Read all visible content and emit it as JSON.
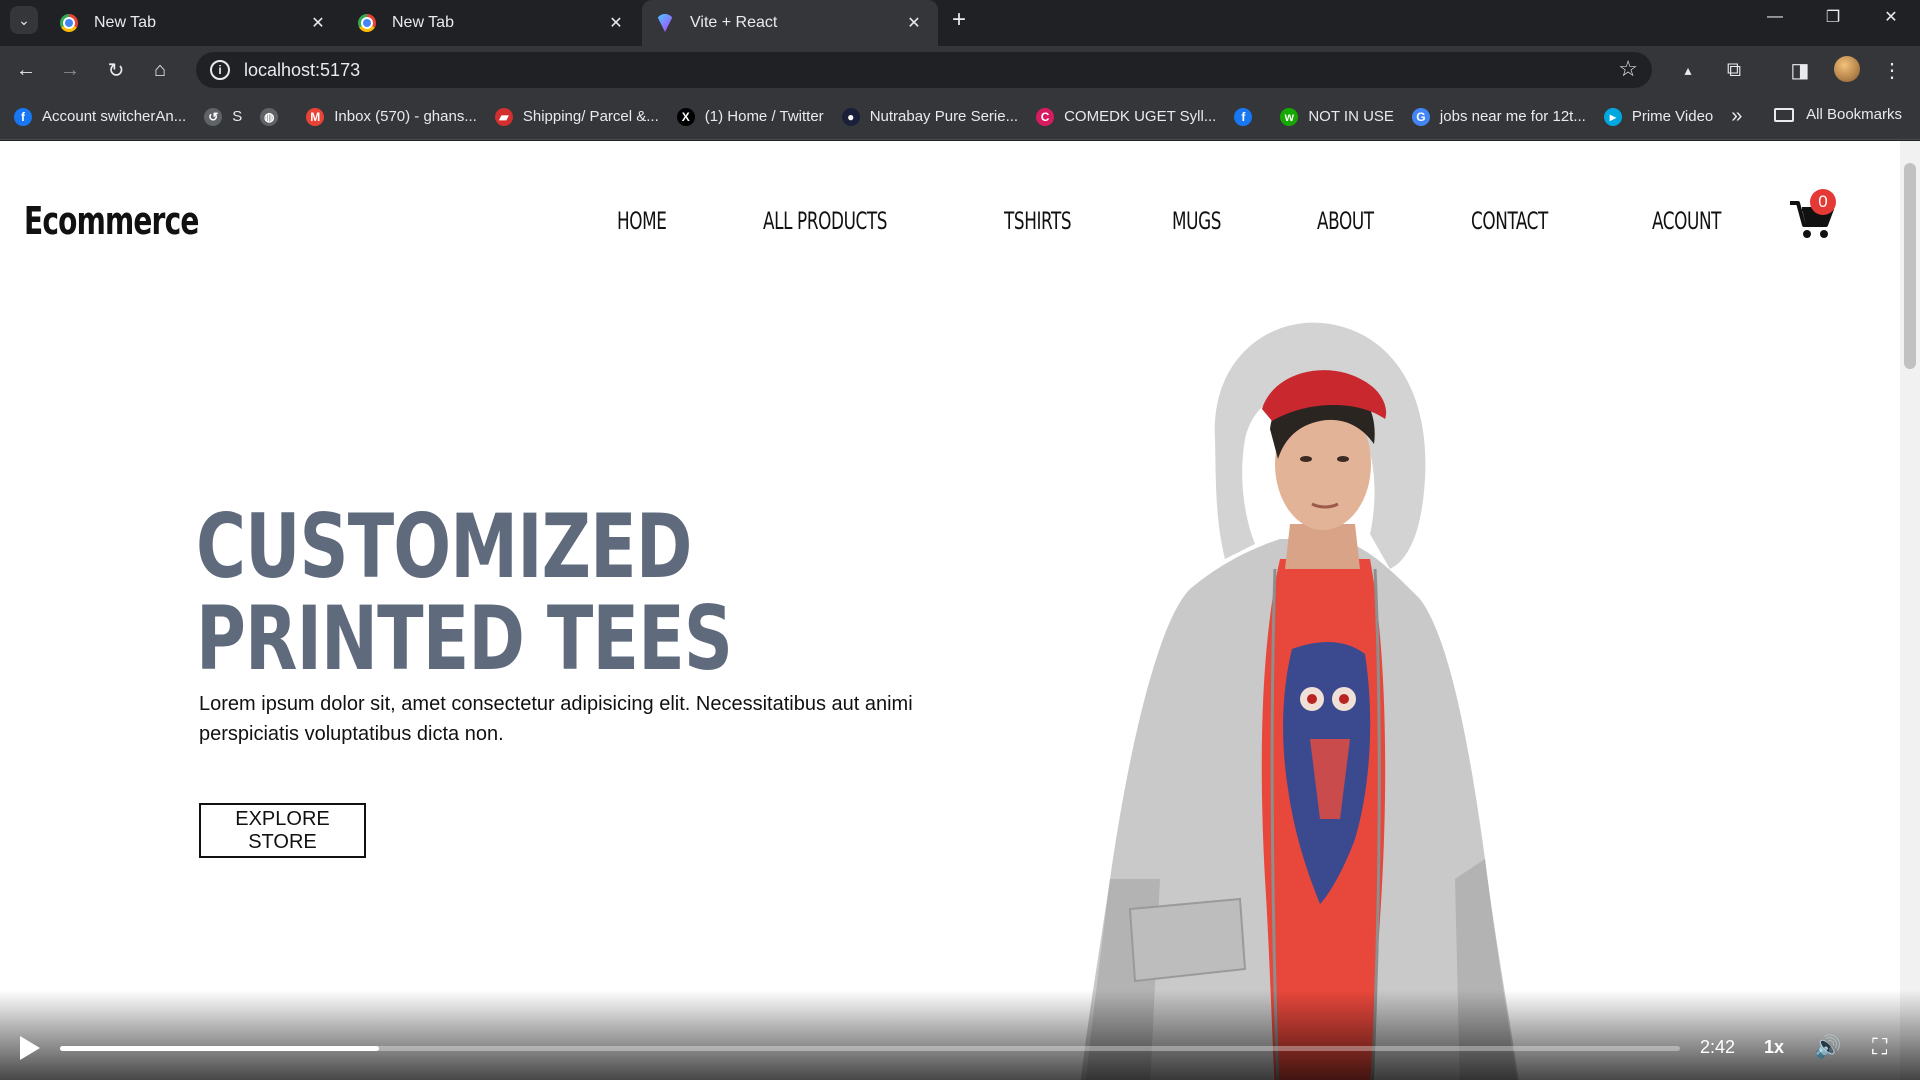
{
  "browser": {
    "tabs": [
      {
        "label": "New Tab",
        "favicon": "chrome-icon"
      },
      {
        "label": "New Tab",
        "favicon": "chrome-icon"
      },
      {
        "label": "Vite + React",
        "favicon": "vite-icon",
        "active": true
      }
    ],
    "url": "localhost:5173",
    "bookmarks": [
      {
        "label": "Account switcherAn...",
        "icon": "facebook-icon",
        "color": "#1877f2"
      },
      {
        "label": "S",
        "icon": "history-icon",
        "color": "#5f6368"
      },
      {
        "label": "",
        "icon": "globe-icon",
        "color": "#5f6368"
      },
      {
        "label": "Inbox (570) - ghans...",
        "icon": "gmail-icon",
        "color": "#ea4335"
      },
      {
        "label": "Shipping/ Parcel &...",
        "icon": "parcel-icon",
        "color": "#d32f2f"
      },
      {
        "label": "(1) Home / Twitter",
        "icon": "x-icon",
        "color": "#000000"
      },
      {
        "label": "Nutrabay Pure Serie...",
        "icon": "nutrabay-icon",
        "color": "#1a1f3a"
      },
      {
        "label": "COMEDK UGET Syll...",
        "icon": "comedk-icon",
        "color": "#d81b60"
      },
      {
        "label": "",
        "icon": "facebook-icon",
        "color": "#1877f2"
      },
      {
        "label": "NOT IN USE",
        "icon": "upwork-icon",
        "color": "#14a800"
      },
      {
        "label": "jobs near me for 12t...",
        "icon": "google-icon",
        "color": "#4285f4"
      },
      {
        "label": "Prime Video",
        "icon": "prime-video-icon",
        "color": "#00a8e1"
      }
    ],
    "all_bookmarks": "All Bookmarks"
  },
  "site": {
    "logo": "Ecommerce",
    "nav": [
      "HOME",
      "ALL PRODUCTS",
      "TSHIRTS",
      "MUGS",
      "ABOUT",
      "CONTACT",
      "ACOUNT"
    ],
    "cart_count": "0"
  },
  "hero": {
    "title_line1": "CUSTOMIZED",
    "title_line2": "PRINTED TEES",
    "text": "Lorem ipsum dolor sit, amet consectetur adipisicing elit. Necessitatibus aut animi perspiciatis voluptatibus dicta non.",
    "button": "EXPLORE STORE"
  },
  "video": {
    "time": "2:42",
    "speed": "1x",
    "progress": 0.197
  },
  "colors": {
    "hero_title": "#5f6b7d",
    "badge": "#e53935"
  }
}
